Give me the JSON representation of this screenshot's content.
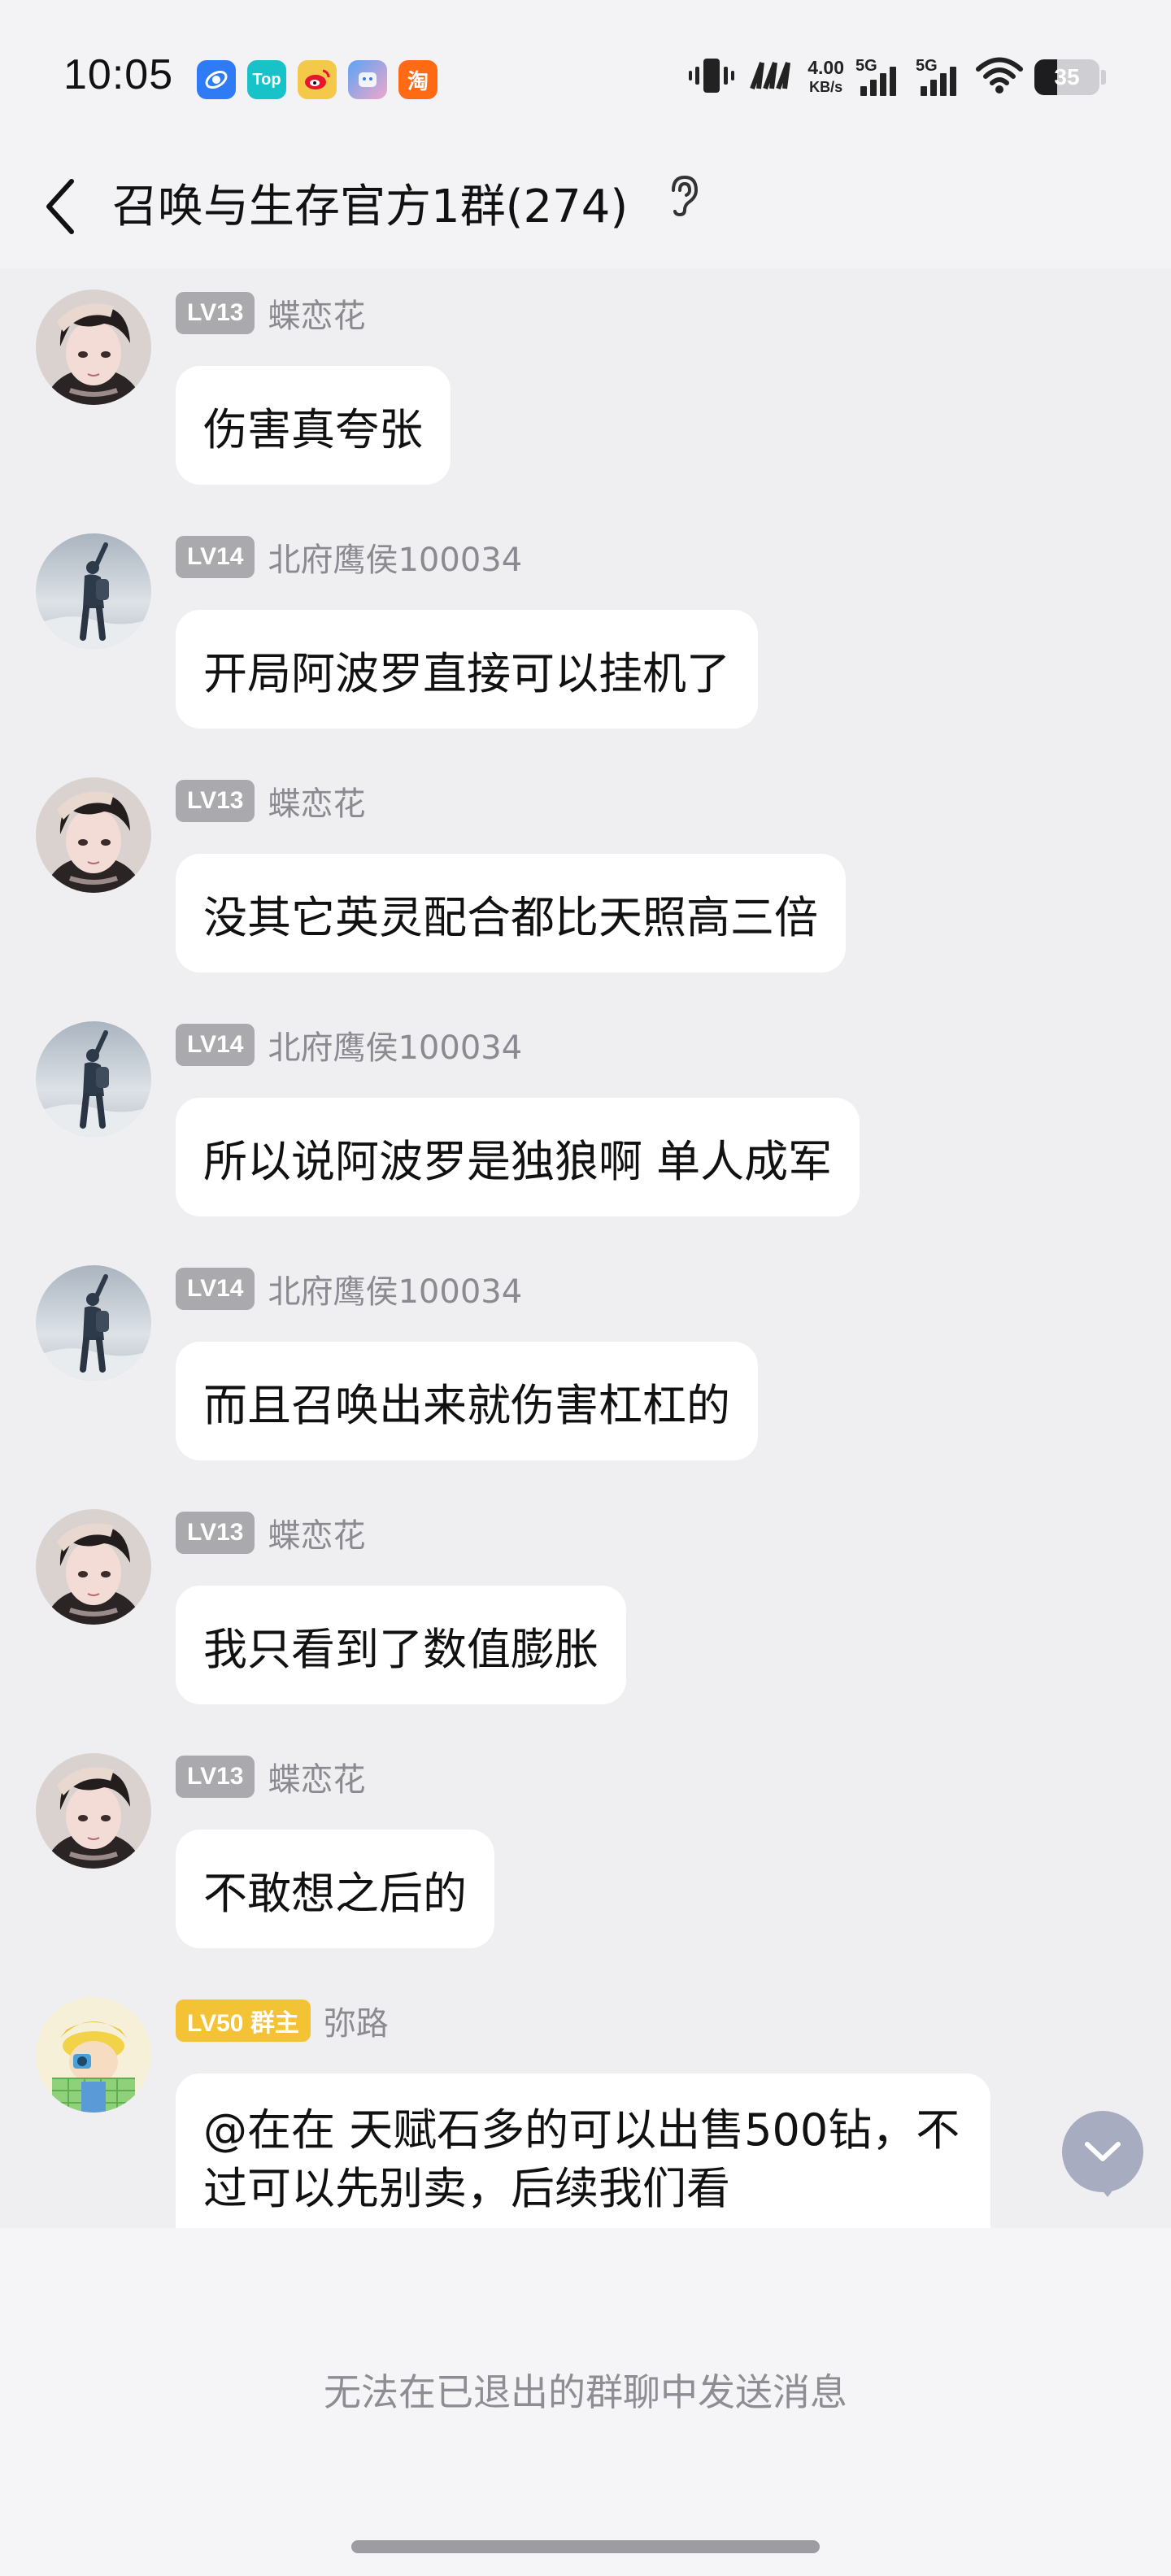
{
  "status_bar": {
    "time": "10:05",
    "app_icons": [
      {
        "name": "browser-app-icon",
        "label": "",
        "color": "#2f7bf6"
      },
      {
        "name": "top-app-icon",
        "label": "Top",
        "color": "#17c3c9"
      },
      {
        "name": "weibo-app-icon",
        "label": "",
        "color": "#f4c94a"
      },
      {
        "name": "finder-app-icon",
        "label": "",
        "color": "#5aa3f7"
      },
      {
        "name": "taobao-app-icon",
        "label": "淘",
        "color": "#ff6a14"
      }
    ],
    "net_speed_value": "4.00",
    "net_speed_unit": "KB/s",
    "signal_1_label": "5G",
    "signal_2_label": "5G",
    "battery_level": "35",
    "battery_fraction": 0.35
  },
  "header": {
    "title": "召唤与生存官方1群(274)"
  },
  "messages": [
    {
      "level": "LV13",
      "name": "蝶恋花",
      "text": "伤害真夸张",
      "avatar": "anime"
    },
    {
      "level": "LV14",
      "name": "北府鹰侯100034",
      "text": "开局阿波罗直接可以挂机了",
      "avatar": "hiker"
    },
    {
      "level": "LV13",
      "name": "蝶恋花",
      "text": "没其它英灵配合都比天照高三倍",
      "avatar": "anime"
    },
    {
      "level": "LV14",
      "name": "北府鹰侯100034",
      "text": "所以说阿波罗是独狼啊 单人成军",
      "avatar": "hiker"
    },
    {
      "level": "LV14",
      "name": "北府鹰侯100034",
      "text": "而且召唤出来就伤害杠杠的",
      "avatar": "hiker"
    },
    {
      "level": "LV13",
      "name": "蝶恋花",
      "text": "我只看到了数值膨胀",
      "avatar": "anime"
    },
    {
      "level": "LV13",
      "name": "蝶恋花",
      "text": "不敢想之后的",
      "avatar": "anime"
    },
    {
      "level": "LV50 群主",
      "name": "弥路",
      "text": "@在在 天赋石多的可以出售500钻，不过可以先别卖，后续我们看",
      "avatar": "cartoon"
    }
  ],
  "footer": {
    "notice": "无法在已退出的群聊中发送消息"
  },
  "colors": {
    "background": "#efeff2",
    "bubble": "#ffffff",
    "level_badge": "#a9a9ae",
    "owner_badge": "#f3c235",
    "nickname": "#8a8a90",
    "scroll_button": "#a7acc0"
  }
}
